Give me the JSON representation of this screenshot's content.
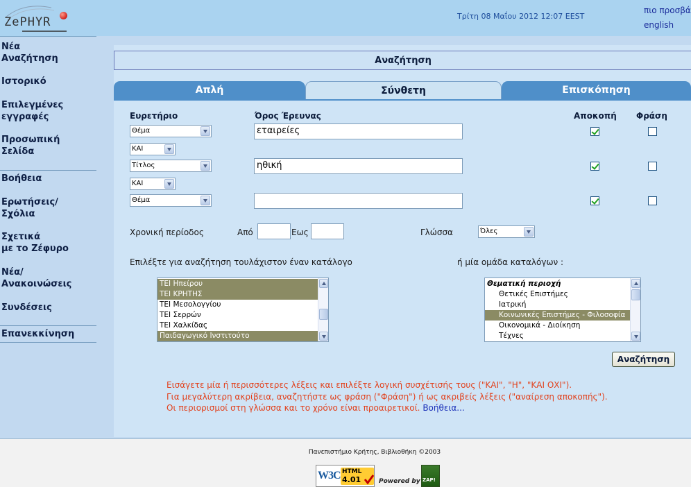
{
  "header": {
    "logo_text": "ZePHYR",
    "datetime": "Τρίτη 08 Μαΐου 2012 12:07 EEST",
    "lang_greek": "πιο προσβά",
    "lang_english": "english"
  },
  "sidebar": {
    "items": [
      {
        "label": "Νέα\nΑναζήτηση"
      },
      {
        "label": "Ιστορικό"
      },
      {
        "label": "Επιλεγμένες\nεγγραφές"
      },
      {
        "label": "Προσωπική\nΣελίδα"
      },
      {
        "label": "Βοήθεια"
      },
      {
        "label": "Ερωτήσεις/\nΣχόλια"
      },
      {
        "label": "Σχετικά\nμε το Ζέφυρο"
      },
      {
        "label": "Νέα/\nΑνακοινώσεις"
      },
      {
        "label": "Συνδέσεις"
      },
      {
        "label": "Επανεκκίνηση"
      }
    ]
  },
  "main": {
    "title": "Αναζήτηση",
    "tabs": [
      {
        "label": "Απλή",
        "active": false
      },
      {
        "label": "Σύνθετη",
        "active": true
      },
      {
        "label": "Επισκόπηση",
        "active": false
      }
    ],
    "columns": {
      "index": "Ευρετήριο",
      "term": "Όρος Έρευνας",
      "truncation": "Αποκοπή",
      "phrase": "Φράση"
    },
    "rows": [
      {
        "index": "Θέμα",
        "term": "εταιρείες",
        "truncation": true,
        "phrase": false
      },
      {
        "index": "Τίτλος",
        "term": "ηθική",
        "truncation": true,
        "phrase": false
      },
      {
        "index": "Θέμα",
        "term": "",
        "truncation": true,
        "phrase": false
      }
    ],
    "operators": [
      "ΚΑΙ",
      "ΚΑΙ"
    ],
    "period": {
      "label": "Χρονική περίοδος",
      "from_label": "Από",
      "to_label": "Εως",
      "from_value": "",
      "to_value": ""
    },
    "language": {
      "label": "Γλώσσα",
      "value": "Όλες"
    },
    "catalogs": {
      "label": "Επιλέξτε για αναζήτηση τουλάχιστον έναν κατάλογο",
      "items": [
        {
          "label": "ΤΕΙ Ηπείρου",
          "selected": true
        },
        {
          "label": "ΤΕΙ ΚΡΗΤΗΣ",
          "selected": true
        },
        {
          "label": "ΤΕΙ Μεσολογγίου",
          "selected": false
        },
        {
          "label": "ΤΕΙ Σερρών",
          "selected": false
        },
        {
          "label": "ΤΕΙ Χαλκίδας",
          "selected": false
        },
        {
          "label": "Παιδαγωγικό Ινστιτούτο",
          "selected": true
        }
      ]
    },
    "catalog_groups": {
      "label": "ή μία ομάδα καταλόγων :",
      "items": [
        {
          "label": "Θεματική περιοχή",
          "selected": false,
          "header": true
        },
        {
          "label": "Θετικές Επιστήμες",
          "selected": false,
          "header": false
        },
        {
          "label": "Ιατρική",
          "selected": false,
          "header": false
        },
        {
          "label": "Κοινωνικές Επιστήμες - Φιλοσοφία",
          "selected": true,
          "header": false
        },
        {
          "label": "Οικονομικά - Διοίκηση",
          "selected": false,
          "header": false
        },
        {
          "label": "Τέχνες",
          "selected": false,
          "header": false
        }
      ]
    },
    "search_button": "Αναζήτηση",
    "help_lines": [
      "Εισάγετε μία ή περισσότερες λέξεις και επιλέξτε λογική συσχέτισής τους (\"ΚΑΙ\", \"Η\", \"ΚΑΙ ΟΧΙ\").",
      "Για μεγαλύτερη ακρίβεια, αναζητήστε ως φράση (\"Φράση\") ή ως ακριβείς λέξεις (\"αναίρεση αποκοπής\").",
      "Οι περιορισμοί στη γλώσσα και το χρόνο είναι προαιρετικοί."
    ],
    "help_link": "Βοήθεια..."
  },
  "footer": {
    "copyright": "Πανεπιστήμιο Κρήτης, Βιβλιοθήκη ©2003",
    "w3c_logo": "W3C",
    "w3c_html": "HTML",
    "w3c_version": "4.01",
    "powered_by": "Powered by",
    "zap": "ZAP!"
  },
  "colors": {
    "header_bg": "#aad3f0",
    "sidebar_bg": "#c2d9f0",
    "tab_inactive": "#4f8fc9",
    "help_text": "#e2411c",
    "selection": "#8b8b64"
  }
}
